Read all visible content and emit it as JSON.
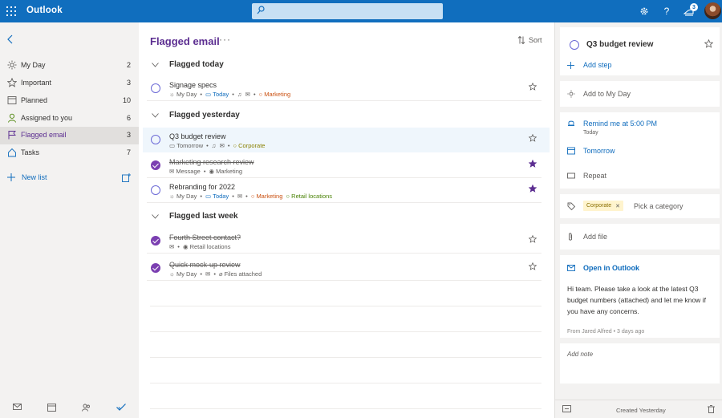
{
  "app": {
    "name": "Outlook",
    "notification_count": "3"
  },
  "sidebar": {
    "items": [
      {
        "label": "My Day",
        "count": "2",
        "icon": "sun-icon"
      },
      {
        "label": "Important",
        "count": "3",
        "icon": "star-icon"
      },
      {
        "label": "Planned",
        "count": "10",
        "icon": "calendar-icon"
      },
      {
        "label": "Assigned to you",
        "count": "6",
        "icon": "person-icon"
      },
      {
        "label": "Flagged email",
        "count": "3",
        "icon": "flag-icon",
        "active": true
      },
      {
        "label": "Tasks",
        "count": "7",
        "icon": "home-icon"
      }
    ],
    "new_list": "New list"
  },
  "main": {
    "title": "Flagged email",
    "more": "···",
    "sort_label": "Sort",
    "groups": [
      {
        "label": "Flagged today"
      },
      {
        "label": "Flagged yesterday"
      },
      {
        "label": "Flagged last week"
      }
    ],
    "tasks": [
      {
        "title": "Signage specs",
        "done": false,
        "important": false,
        "meta": {
          "myday": "My Day",
          "due": "Today",
          "category": "Marketing"
        }
      },
      {
        "title": "Q3 budget review",
        "done": false,
        "important": false,
        "meta": {
          "due": "Tomorrow",
          "category": "Corporate"
        }
      },
      {
        "title": "Marketing research review",
        "done": true,
        "important": true,
        "meta": {
          "source": "Message",
          "category": "Marketing"
        }
      },
      {
        "title": "Rebranding for 2022",
        "done": false,
        "important": true,
        "meta": {
          "myday": "My Day",
          "due": "Today",
          "category": "Marketing",
          "category2": "Retail locations"
        }
      },
      {
        "title": "Fourth Street contact?",
        "done": true,
        "important": false,
        "meta": {
          "category": "Retail locations"
        }
      },
      {
        "title": "Quick mock-up review",
        "done": true,
        "important": false,
        "meta": {
          "myday": "My Day",
          "files": "Files attached"
        }
      }
    ]
  },
  "details": {
    "title": "Q3 budget review",
    "add_step": "Add step",
    "add_to_my_day": "Add to My Day",
    "remind": "Remind me at 5:00 PM",
    "remind_sub": "Today",
    "due": "Tomorrow",
    "repeat": "Repeat",
    "category_chip": "Corporate",
    "pick_category": "Pick a category",
    "add_file": "Add file",
    "open_in_outlook": "Open in Outlook",
    "note_body": "Hi team. Please take a look at the latest Q3 budget numbers (attached) and let me know if you have any concerns.",
    "note_from": "From Jared Alfred",
    "note_time": "3 days ago",
    "add_note": "Add note",
    "created": "Created Yesterday"
  },
  "colors": {
    "brand": "#106ebe",
    "accent_purple": "#5c2e91",
    "link_blue": "#0f6cbd"
  }
}
